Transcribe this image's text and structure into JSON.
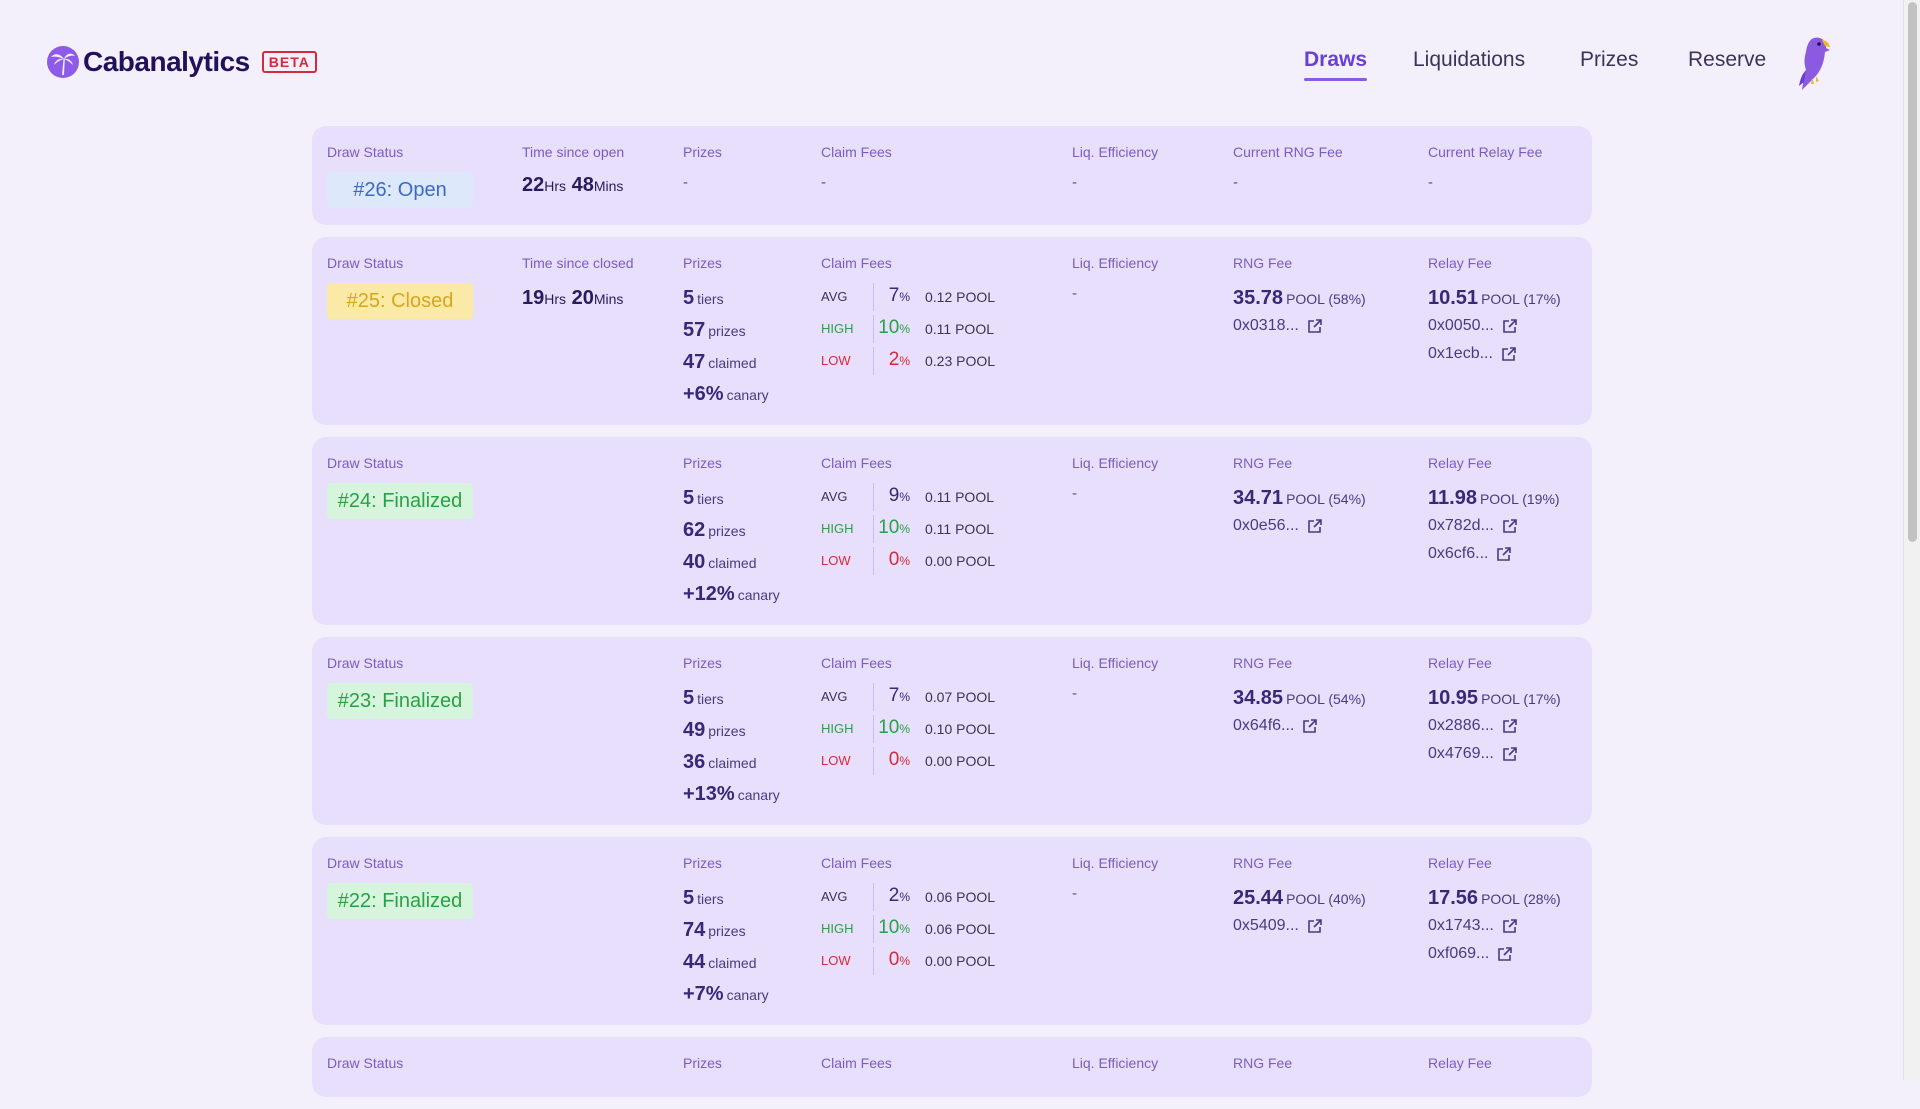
{
  "app": {
    "name": "Cabanalytics",
    "beta": "BETA"
  },
  "nav": [
    {
      "label": "Draws",
      "active": true
    },
    {
      "label": "Liquidations",
      "active": false
    },
    {
      "label": "Prizes",
      "active": false
    },
    {
      "label": "Reserve",
      "active": false
    }
  ],
  "open_draw": {
    "labels": {
      "status": "Draw Status",
      "time": "Time since open",
      "prizes": "Prizes",
      "claim": "Claim Fees",
      "liq": "Liq. Efficiency",
      "rng": "Current RNG Fee",
      "relay": "Current Relay Fee"
    },
    "status": "#26: Open",
    "time": {
      "hrs": "22",
      "hrs_unit": "Hrs",
      "mins": "48",
      "mins_unit": "Mins"
    },
    "prizes": "-",
    "claim": "-",
    "liq": "-",
    "rng": "-",
    "relay": "-"
  },
  "closed_draw": {
    "labels": {
      "status": "Draw Status",
      "time": "Time since closed",
      "prizes": "Prizes",
      "claim": "Claim Fees",
      "liq": "Liq. Efficiency",
      "rng": "RNG Fee",
      "relay": "Relay Fee"
    },
    "status": "#25: Closed",
    "time": {
      "hrs": "19",
      "hrs_unit": "Hrs",
      "mins": "20",
      "mins_unit": "Mins"
    },
    "prizes": {
      "tiers": "5",
      "tiers_label": "tiers",
      "prizes": "57",
      "prizes_label": "prizes",
      "claimed": "47",
      "claimed_label": "claimed",
      "canary": "+6%",
      "canary_label": "canary"
    },
    "claim": {
      "avg_label": "AVG",
      "avg_pct": "7",
      "avg_pool": "0.12 POOL",
      "high_label": "HIGH",
      "high_pct": "10",
      "high_pool": "0.11 POOL",
      "low_label": "LOW",
      "low_pct": "2",
      "low_pool": "0.23 POOL",
      "pct_sign": "%"
    },
    "liq": "-",
    "rng": {
      "value": "35.78",
      "detail": "POOL (58%)",
      "tx": "0x0318..."
    },
    "relay": {
      "value": "10.51",
      "detail": "POOL (17%)",
      "tx1": "0x0050...",
      "tx2": "0x1ecb..."
    }
  },
  "finalized_draws": [
    {
      "status": "#24: Finalized",
      "prizes": {
        "tiers": "5",
        "tiers_label": "tiers",
        "prizes": "62",
        "prizes_label": "prizes",
        "claimed": "40",
        "claimed_label": "claimed",
        "canary": "+12%",
        "canary_label": "canary"
      },
      "claim": {
        "avg_label": "AVG",
        "avg_pct": "9",
        "avg_pool": "0.11 POOL",
        "high_label": "HIGH",
        "high_pct": "10",
        "high_pool": "0.11 POOL",
        "low_label": "LOW",
        "low_pct": "0",
        "low_pool": "0.00 POOL",
        "pct_sign": "%"
      },
      "liq": "-",
      "rng": {
        "value": "34.71",
        "detail": "POOL (54%)",
        "tx": "0x0e56..."
      },
      "relay": {
        "value": "11.98",
        "detail": "POOL (19%)",
        "tx1": "0x782d...",
        "tx2": "0x6cf6..."
      }
    },
    {
      "status": "#23: Finalized",
      "prizes": {
        "tiers": "5",
        "tiers_label": "tiers",
        "prizes": "49",
        "prizes_label": "prizes",
        "claimed": "36",
        "claimed_label": "claimed",
        "canary": "+13%",
        "canary_label": "canary"
      },
      "claim": {
        "avg_label": "AVG",
        "avg_pct": "7",
        "avg_pool": "0.07 POOL",
        "high_label": "HIGH",
        "high_pct": "10",
        "high_pool": "0.10 POOL",
        "low_label": "LOW",
        "low_pct": "0",
        "low_pool": "0.00 POOL",
        "pct_sign": "%"
      },
      "liq": "-",
      "rng": {
        "value": "34.85",
        "detail": "POOL (54%)",
        "tx": "0x64f6..."
      },
      "relay": {
        "value": "10.95",
        "detail": "POOL (17%)",
        "tx1": "0x2886...",
        "tx2": "0x4769..."
      }
    },
    {
      "status": "#22: Finalized",
      "prizes": {
        "tiers": "5",
        "tiers_label": "tiers",
        "prizes": "74",
        "prizes_label": "prizes",
        "claimed": "44",
        "claimed_label": "claimed",
        "canary": "+7%",
        "canary_label": "canary"
      },
      "claim": {
        "avg_label": "AVG",
        "avg_pct": "2",
        "avg_pool": "0.06 POOL",
        "high_label": "HIGH",
        "high_pct": "10",
        "high_pool": "0.06 POOL",
        "low_label": "LOW",
        "low_pct": "0",
        "low_pool": "0.00 POOL",
        "pct_sign": "%"
      },
      "liq": "-",
      "rng": {
        "value": "25.44",
        "detail": "POOL (40%)",
        "tx": "0x5409..."
      },
      "relay": {
        "value": "17.56",
        "detail": "POOL (28%)",
        "tx1": "0x1743...",
        "tx2": "0xf069..."
      }
    }
  ],
  "final_labels": {
    "status": "Draw Status",
    "prizes": "Prizes",
    "claim": "Claim Fees",
    "liq": "Liq. Efficiency",
    "rng": "RNG Fee",
    "relay": "Relay Fee"
  },
  "icons": {
    "logo": "palm-tree-icon",
    "mascot": "parrot-icon",
    "external": "external-link-icon"
  },
  "colors": {
    "accent": "#6a40d4",
    "card": "#e7dffb",
    "open": "#3a6bc8",
    "closed": "#d9a51a",
    "finalized": "#2aa146",
    "low": "#d42a3a"
  }
}
